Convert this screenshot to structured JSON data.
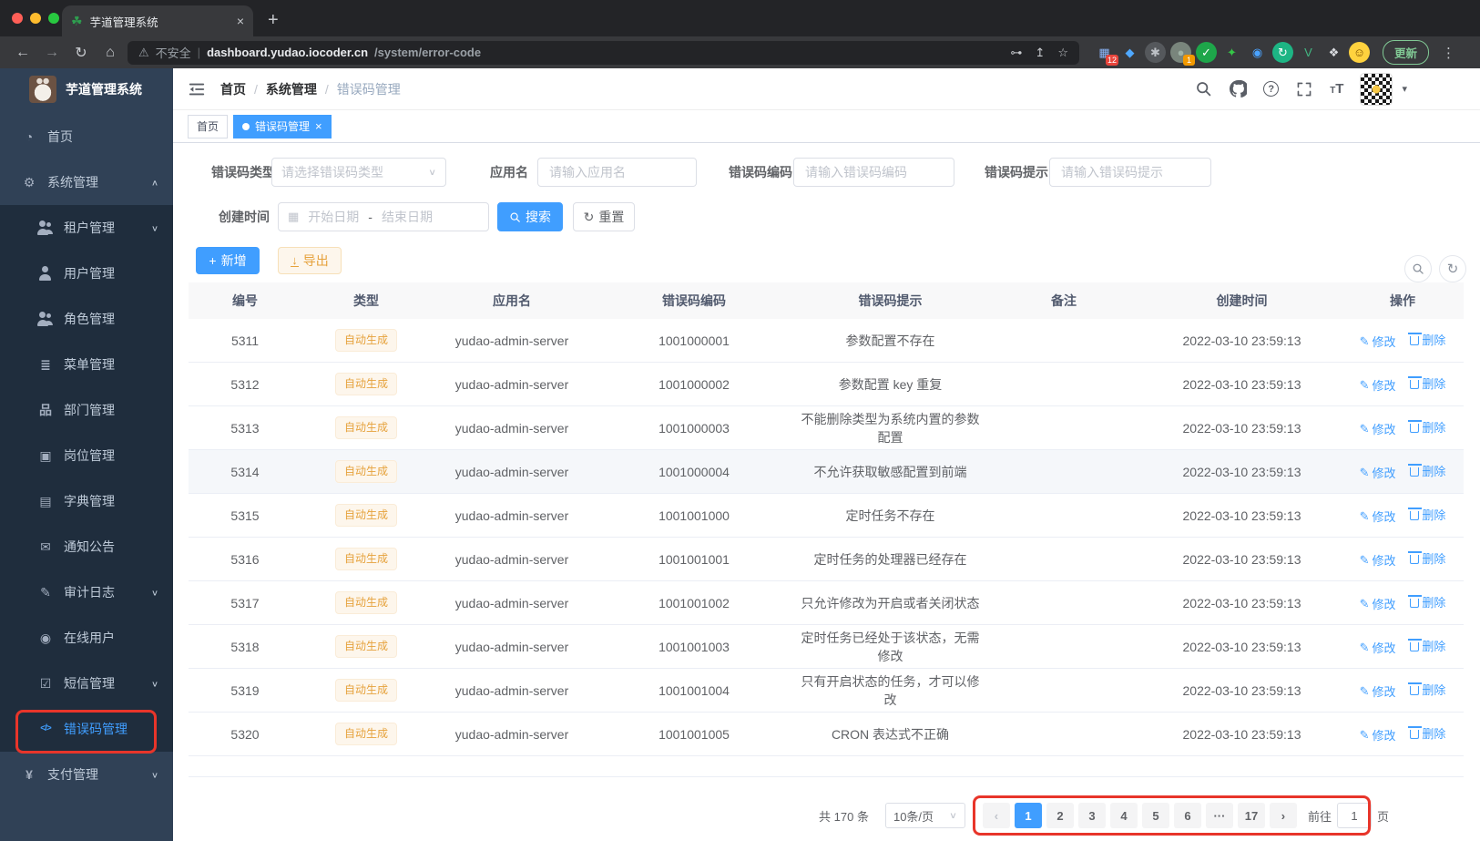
{
  "colors": {
    "accent": "#409eff",
    "warning": "#e6a23c",
    "annotation_red": "#e8352a",
    "sidebar_bg": "#304156",
    "submenu_bg": "#1f2d3d"
  },
  "browser": {
    "tab_title": "芋道管理系统",
    "tab_close_glyph": "×",
    "new_tab_glyph": "+",
    "back_glyph": "←",
    "forward_glyph": "→",
    "reload_glyph": "↻",
    "home_glyph": "⌂",
    "warning_glyph": "⚠",
    "security_label": "不安全",
    "url_domain": "dashboard.yudao.iocoder.cn",
    "url_path": "/system/error-code",
    "key_glyph": "⊶",
    "share_glyph": "↥",
    "star_glyph": "☆",
    "update_label": "更新",
    "menu_dots_glyph": "⋮",
    "extensions": [
      {
        "name": "pinned-grid-extension-icon",
        "glyph": "▦",
        "fg": "#8ab4f8",
        "bg": "transparent",
        "badge": "12",
        "badge_bg": "#e8453c"
      },
      {
        "name": "kite-extension-icon",
        "glyph": "◆",
        "fg": "#4fa8ff",
        "bg": "transparent"
      },
      {
        "name": "asterisk-extension-icon",
        "glyph": "✱",
        "fg": "#bdc1c6",
        "bg": "#55585c"
      },
      {
        "name": "notifier-extension-icon",
        "glyph": "●",
        "fg": "#9fb3a6",
        "bg": "#79857c",
        "badge": "1",
        "badge_bg": "#f29900"
      },
      {
        "name": "green-check-extension-icon",
        "glyph": "✓",
        "fg": "#ffffff",
        "bg": "#1ea64a"
      },
      {
        "name": "star-outline-extension-icon",
        "glyph": "✦",
        "fg": "#35c747",
        "bg": "transparent"
      },
      {
        "name": "eye-extension-icon",
        "glyph": "◉",
        "fg": "#4aa3ff",
        "bg": "transparent"
      },
      {
        "name": "sync-extension-icon",
        "glyph": "↻",
        "fg": "#ffffff",
        "bg": "#1db584"
      },
      {
        "name": "vue-devtools-extension-icon",
        "glyph": "V",
        "fg": "#42b883",
        "bg": "transparent"
      },
      {
        "name": "puzzle-extension-icon",
        "glyph": "❖",
        "fg": "#dadce0",
        "bg": "transparent"
      },
      {
        "name": "emoji-extension-icon",
        "glyph": "☺",
        "fg": "#7a4f01",
        "bg": "#ffd23e"
      }
    ]
  },
  "sidebar": {
    "logo_title": "芋道管理系统",
    "items": [
      {
        "label": "首页",
        "glyph": "◔",
        "icon": "dashboard-icon"
      },
      {
        "label": "系统管理",
        "glyph": "⚙",
        "icon": "gear-icon",
        "arrow": "∧"
      },
      {
        "label": "租户管理",
        "glyph": "",
        "icon": "users-icon",
        "sub": true,
        "arrow": "∨"
      },
      {
        "label": "用户管理",
        "glyph": "",
        "icon": "user-icon",
        "sub": true
      },
      {
        "label": "角色管理",
        "glyph": "",
        "icon": "users-icon",
        "sub": true
      },
      {
        "label": "菜单管理",
        "glyph": "≣",
        "icon": "menu-tree-icon",
        "sub": true
      },
      {
        "label": "部门管理",
        "glyph": "品",
        "icon": "org-tree-icon",
        "sub": true
      },
      {
        "label": "岗位管理",
        "glyph": "▣",
        "icon": "badge-icon",
        "sub": true
      },
      {
        "label": "字典管理",
        "glyph": "▤",
        "icon": "dictionary-icon",
        "sub": true
      },
      {
        "label": "通知公告",
        "glyph": "✉",
        "icon": "notice-icon",
        "sub": true
      },
      {
        "label": "审计日志",
        "glyph": "✎",
        "icon": "audit-log-icon",
        "sub": true,
        "arrow": "∨"
      },
      {
        "label": "在线用户",
        "glyph": "◉",
        "icon": "online-users-icon",
        "sub": true
      },
      {
        "label": "短信管理",
        "glyph": "☑",
        "icon": "sms-shield-icon",
        "sub": true,
        "arrow": "∨"
      },
      {
        "label": "错误码管理",
        "glyph": "</>",
        "icon": "error-code-icon",
        "sub": true,
        "active": true
      },
      {
        "label": "支付管理",
        "glyph": "¥",
        "icon": "payment-icon",
        "arrow": "∨"
      }
    ]
  },
  "header": {
    "breadcrumb": [
      "首页",
      "系统管理",
      "错误码管理"
    ],
    "separator": "/"
  },
  "tags": [
    {
      "label": "首页"
    },
    {
      "label": "错误码管理",
      "active": true,
      "close_glyph": "×"
    }
  ],
  "filters": {
    "type_label": "错误码类型",
    "type_placeholder": "请选择错误码类型",
    "select_caret": "∨",
    "app_label": "应用名",
    "app_placeholder": "请输入应用名",
    "code_label": "错误码编码",
    "code_placeholder": "请输入错误码编码",
    "msg_label": "错误码提示",
    "msg_placeholder": "请输入错误码提示",
    "time_label": "创建时间",
    "calendar_glyph": "▦",
    "start_placeholder": "开始日期",
    "range_separator": "-",
    "end_placeholder": "结束日期",
    "search_label": "搜索",
    "reset_label": "重置",
    "reset_glyph": "↻"
  },
  "toolbar": {
    "add_label": "新增",
    "add_glyph": "+",
    "export_label": "导出",
    "export_glyph": "↓",
    "refresh_glyph": "↻"
  },
  "table": {
    "headers": [
      "编号",
      "类型",
      "应用名",
      "错误码编码",
      "错误码提示",
      "备注",
      "创建时间",
      "操作"
    ],
    "edit_label": "修改",
    "edit_glyph": "✎",
    "delete_label": "删除",
    "rows": [
      {
        "id": "5311",
        "type": "自动生成",
        "app": "yudao-admin-server",
        "code": "1001000001",
        "msg": "参数配置不存在",
        "remark": "",
        "time": "2022-03-10 23:59:13"
      },
      {
        "id": "5312",
        "type": "自动生成",
        "app": "yudao-admin-server",
        "code": "1001000002",
        "msg": "参数配置 key 重复",
        "remark": "",
        "time": "2022-03-10 23:59:13"
      },
      {
        "id": "5313",
        "type": "自动生成",
        "app": "yudao-admin-server",
        "code": "1001000003",
        "msg": "不能删除类型为系统内置的参数配置",
        "remark": "",
        "time": "2022-03-10 23:59:13"
      },
      {
        "id": "5314",
        "type": "自动生成",
        "app": "yudao-admin-server",
        "code": "1001000004",
        "msg": "不允许获取敏感配置到前端",
        "remark": "",
        "time": "2022-03-10 23:59:13",
        "highlight": true
      },
      {
        "id": "5315",
        "type": "自动生成",
        "app": "yudao-admin-server",
        "code": "1001001000",
        "msg": "定时任务不存在",
        "remark": "",
        "time": "2022-03-10 23:59:13"
      },
      {
        "id": "5316",
        "type": "自动生成",
        "app": "yudao-admin-server",
        "code": "1001001001",
        "msg": "定时任务的处理器已经存在",
        "remark": "",
        "time": "2022-03-10 23:59:13"
      },
      {
        "id": "5317",
        "type": "自动生成",
        "app": "yudao-admin-server",
        "code": "1001001002",
        "msg": "只允许修改为开启或者关闭状态",
        "remark": "",
        "time": "2022-03-10 23:59:13"
      },
      {
        "id": "5318",
        "type": "自动生成",
        "app": "yudao-admin-server",
        "code": "1001001003",
        "msg": "定时任务已经处于该状态，无需修改",
        "remark": "",
        "time": "2022-03-10 23:59:13"
      },
      {
        "id": "5319",
        "type": "自动生成",
        "app": "yudao-admin-server",
        "code": "1001001004",
        "msg": "只有开启状态的任务，才可以修改",
        "remark": "",
        "time": "2022-03-10 23:59:13"
      },
      {
        "id": "5320",
        "type": "自动生成",
        "app": "yudao-admin-server",
        "code": "1001001005",
        "msg": "CRON 表达式不正确",
        "remark": "",
        "time": "2022-03-10 23:59:13"
      }
    ]
  },
  "pagination": {
    "total_label": "共 170 条",
    "page_size_label": "10条/页",
    "select_caret": "∨",
    "prev_glyph": "‹",
    "next_glyph": "›",
    "pages": [
      {
        "label": "1",
        "active": true
      },
      {
        "label": "2"
      },
      {
        "label": "3"
      },
      {
        "label": "4"
      },
      {
        "label": "5"
      },
      {
        "label": "6"
      },
      {
        "label": "···",
        "more": true
      },
      {
        "label": "17"
      }
    ],
    "goto_label": "前往",
    "goto_value": "1",
    "page_unit": "页"
  }
}
